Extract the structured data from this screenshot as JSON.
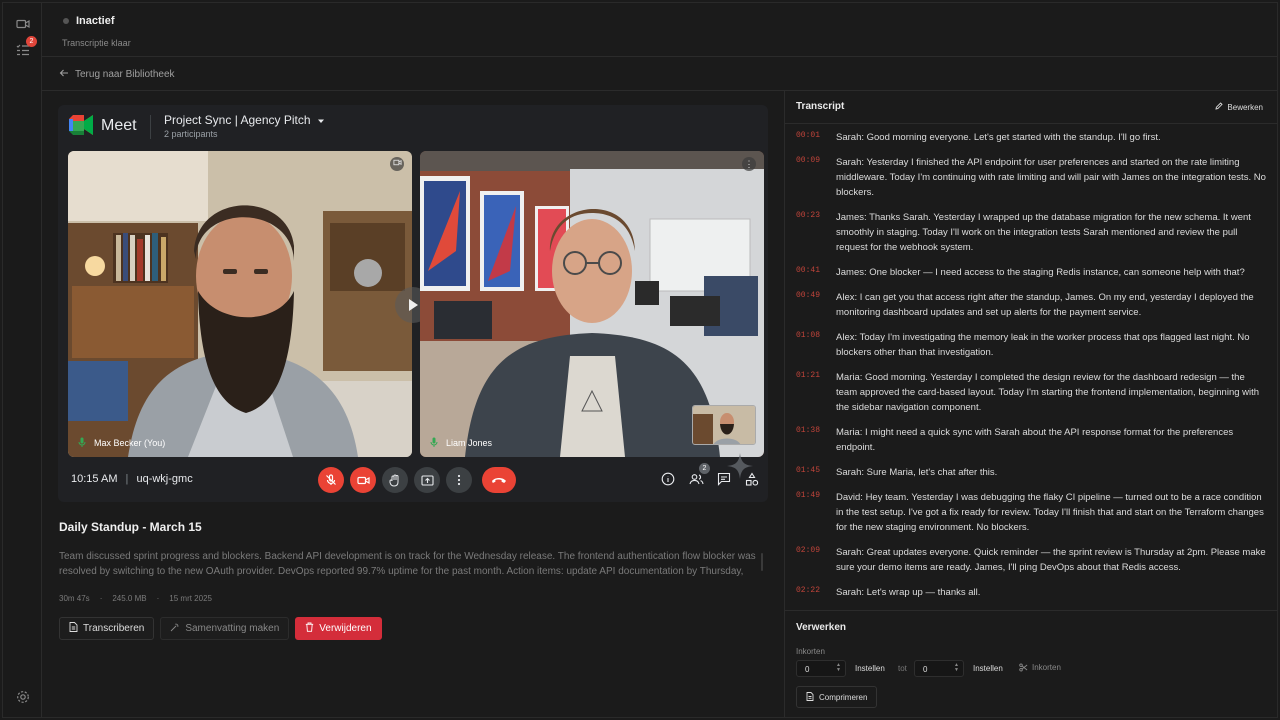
{
  "rail": {
    "notification_count": "2"
  },
  "header": {
    "status": "Inactief",
    "substatus": "Transcriptie klaar"
  },
  "nav": {
    "back_label": "Terug naar Bibliotheek"
  },
  "meet": {
    "logo_word": "Meet",
    "title": "Project Sync | Agency Pitch",
    "participants": "2 participants",
    "tiles": [
      {
        "name": "Max Becker (You)"
      },
      {
        "name": "Liam Jones"
      }
    ],
    "time": "10:15 AM",
    "meeting_code": "uq-wkj-gmc",
    "people_count": "2",
    "colors": {
      "end_call": "#ea4335",
      "background": "#202124"
    }
  },
  "recording": {
    "title": "Daily Standup - March 15",
    "summary": "Team discussed sprint progress and blockers. Backend API development is on track for the Wednesday release. The frontend authentication flow blocker was resolved by switching to the new OAuth provider. DevOps reported 99.7% uptime for the past month. Action items: update API documentation by Thursday,",
    "duration": "30m 47s",
    "size": "245.0 MB",
    "date": "15 mrt 2025",
    "sep": "·",
    "actions": {
      "transcribe": "Transcriberen",
      "summarize": "Samenvatting maken",
      "delete": "Verwijderen"
    }
  },
  "transcript": {
    "title": "Transcript",
    "edit_label": "Bewerken",
    "lines": [
      {
        "time": "00:01",
        "text": "Sarah: Good morning everyone. Let's get started with the standup. I'll go first."
      },
      {
        "time": "00:09",
        "text": "Sarah: Yesterday I finished the API endpoint for user preferences and started on the rate limiting middleware. Today I'm continuing with rate limiting and will pair with James on the integration tests. No blockers."
      },
      {
        "time": "00:23",
        "text": "James: Thanks Sarah. Yesterday I wrapped up the database migration for the new schema. It went smoothly in staging. Today I'll work on the integration tests Sarah mentioned and review the pull request for the webhook system."
      },
      {
        "time": "00:41",
        "text": "James: One blocker — I need access to the staging Redis instance, can someone help with that?"
      },
      {
        "time": "00:49",
        "text": "Alex: I can get you that access right after the standup, James. On my end, yesterday I deployed the monitoring dashboard updates and set up alerts for the payment service."
      },
      {
        "time": "01:08",
        "text": "Alex: Today I'm investigating the memory leak in the worker process that ops flagged last night. No blockers other than that investigation."
      },
      {
        "time": "01:21",
        "text": "Maria: Good morning. Yesterday I completed the design review for the dashboard redesign — the team approved the card-based layout. Today I'm starting the frontend implementation, beginning with the sidebar navigation component."
      },
      {
        "time": "01:38",
        "text": "Maria: I might need a quick sync with Sarah about the API response format for the preferences endpoint."
      },
      {
        "time": "01:45",
        "text": "Sarah: Sure Maria, let's chat after this."
      },
      {
        "time": "01:49",
        "text": "David: Hey team. Yesterday I was debugging the flaky CI pipeline — turned out to be a race condition in the test setup. I've got a fix ready for review. Today I'll finish that and start on the Terraform changes for the new staging environment. No blockers."
      },
      {
        "time": "02:09",
        "text": "Sarah: Great updates everyone. Quick reminder — the sprint review is Thursday at 2pm. Please make sure your demo items are ready. James, I'll ping DevOps about that Redis access."
      },
      {
        "time": "02:22",
        "text": "Sarah: Let's wrap up — thanks all."
      }
    ]
  },
  "process": {
    "title": "Verwerken",
    "trim_label": "Inkorten",
    "start_value": "0",
    "end_value": "0",
    "unit": "Instellen",
    "between": "tot",
    "trim_button": "Inkorten",
    "compress_button": "Comprimeren"
  }
}
